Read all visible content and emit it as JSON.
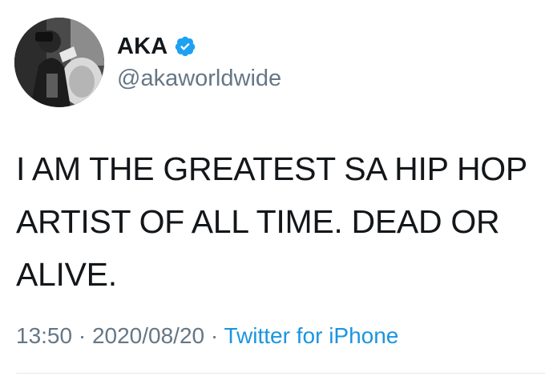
{
  "tweet": {
    "display_name": "AKA",
    "handle": "@akaworldwide",
    "verified": true,
    "text_lines": [
      "I AM THE GREATEST SA HIP HOP",
      "ARTIST OF ALL TIME. DEAD OR",
      "ALIVE."
    ],
    "time": "13:50",
    "date": "2020/08/20",
    "separator": "·",
    "source": "Twitter for iPhone"
  },
  "icons": {
    "avatar": "profile-photo",
    "verified": "verified-badge-icon"
  },
  "colors": {
    "text": "#14171a",
    "secondary": "#657786",
    "link": "#1b95e0",
    "verified": "#1da1f2"
  }
}
